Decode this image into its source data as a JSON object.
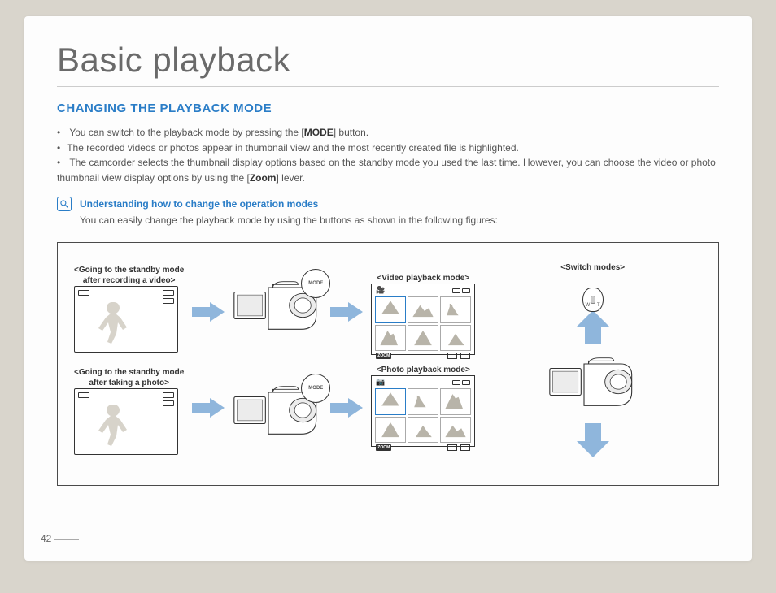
{
  "header": {
    "title": "Basic playback"
  },
  "section": {
    "heading": "CHANGING THE PLAYBACK MODE",
    "bullets": {
      "b1_pre": "You can switch to the playback mode by pressing the [",
      "b1_strong": "MODE",
      "b1_post": "] button.",
      "b2": "The recorded videos or photos appear in thumbnail view and the most recently created file is highlighted.",
      "b3_pre": "The camcorder selects the thumbnail display options based on the standby mode you used the last time. However, you can choose the video or photo thumbnail view display options by using the [",
      "b3_strong": "Zoom",
      "b3_post": "] lever."
    }
  },
  "note": {
    "title": "Understanding how to change the operation modes",
    "body": "You can easily change the playback mode by using the buttons as shown in the following figures:"
  },
  "diagram": {
    "standby_video": "<Going to the standby mode\nafter recording a video>",
    "standby_photo": "<Going to the standby mode\nafter taking a photo>",
    "video_playback": "<Video playback mode>",
    "photo_playback": "<Photo playback mode>",
    "switch_modes": "<Switch modes>",
    "mode_label": "MODE",
    "zoom_label": "ZOOM",
    "wt": {
      "w": "W",
      "t": "T"
    }
  },
  "page_number": "42"
}
